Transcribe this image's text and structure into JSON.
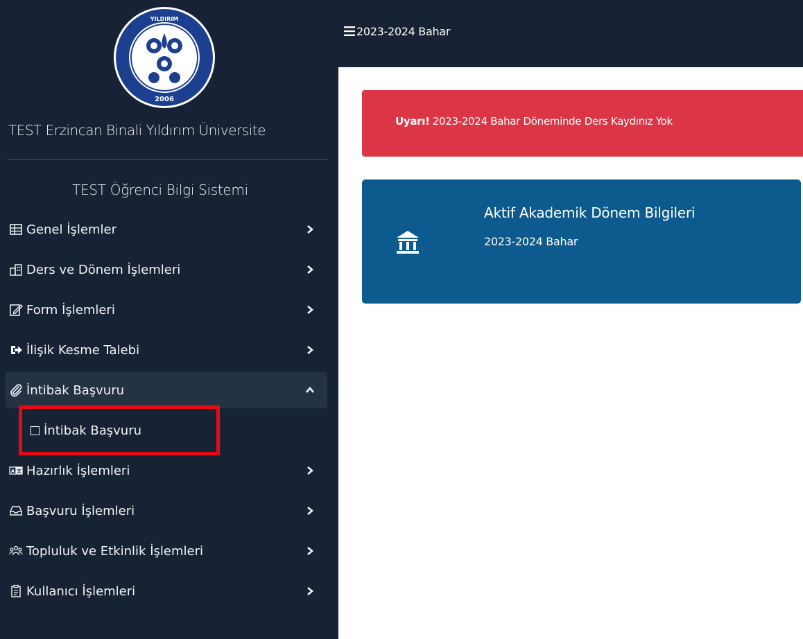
{
  "sidebar": {
    "university_name": "TEST Erzincan Binali Yıldırım Üniversite",
    "system_name": "TEST Öğrenci Bilgi Sistemi",
    "logo": {
      "year": "2006",
      "ring_text": "ERZİNCAN BİNALİ YILDIRIM ÜNİVERSİTESİ"
    },
    "menu": [
      {
        "label": "Genel İşlemler",
        "icon": "table-icon"
      },
      {
        "label": "Ders ve Dönem İşlemleri",
        "icon": "building-icon"
      },
      {
        "label": "Form İşlemleri",
        "icon": "edit-form-icon"
      },
      {
        "label": "İlişik Kesme Talebi",
        "icon": "sign-out-icon"
      },
      {
        "label": "İntibak Başvuru",
        "icon": "paperclip-icon",
        "expanded": true
      },
      {
        "label": "Hazırlık İşlemleri",
        "icon": "language-icon"
      },
      {
        "label": "Başvuru İşlemleri",
        "icon": "inbox-icon"
      },
      {
        "label": "Topluluk ve Etkinlik İşlemleri",
        "icon": "users-icon"
      },
      {
        "label": "Kullanıcı İşlemleri",
        "icon": "clipboard-icon"
      }
    ],
    "submenu": [
      {
        "label": "İntibak Başvuru",
        "icon": "square-icon"
      }
    ]
  },
  "topbar": {
    "term": "2023-2024 Bahar",
    "menu_icon": "hamburger-icon"
  },
  "alert": {
    "strong": "Uyarı!",
    "message": "2023-2024 Bahar Döneminde Ders Kaydınız Yok",
    "color": "#dc3545"
  },
  "card": {
    "title": "Aktif Akademik Dönem Bilgileri",
    "subtitle": "2023-2024 Bahar",
    "icon": "university-icon",
    "color": "#0c5a8e"
  },
  "colors": {
    "sidebar_bg": "#172334",
    "highlight": "#e60b12"
  }
}
